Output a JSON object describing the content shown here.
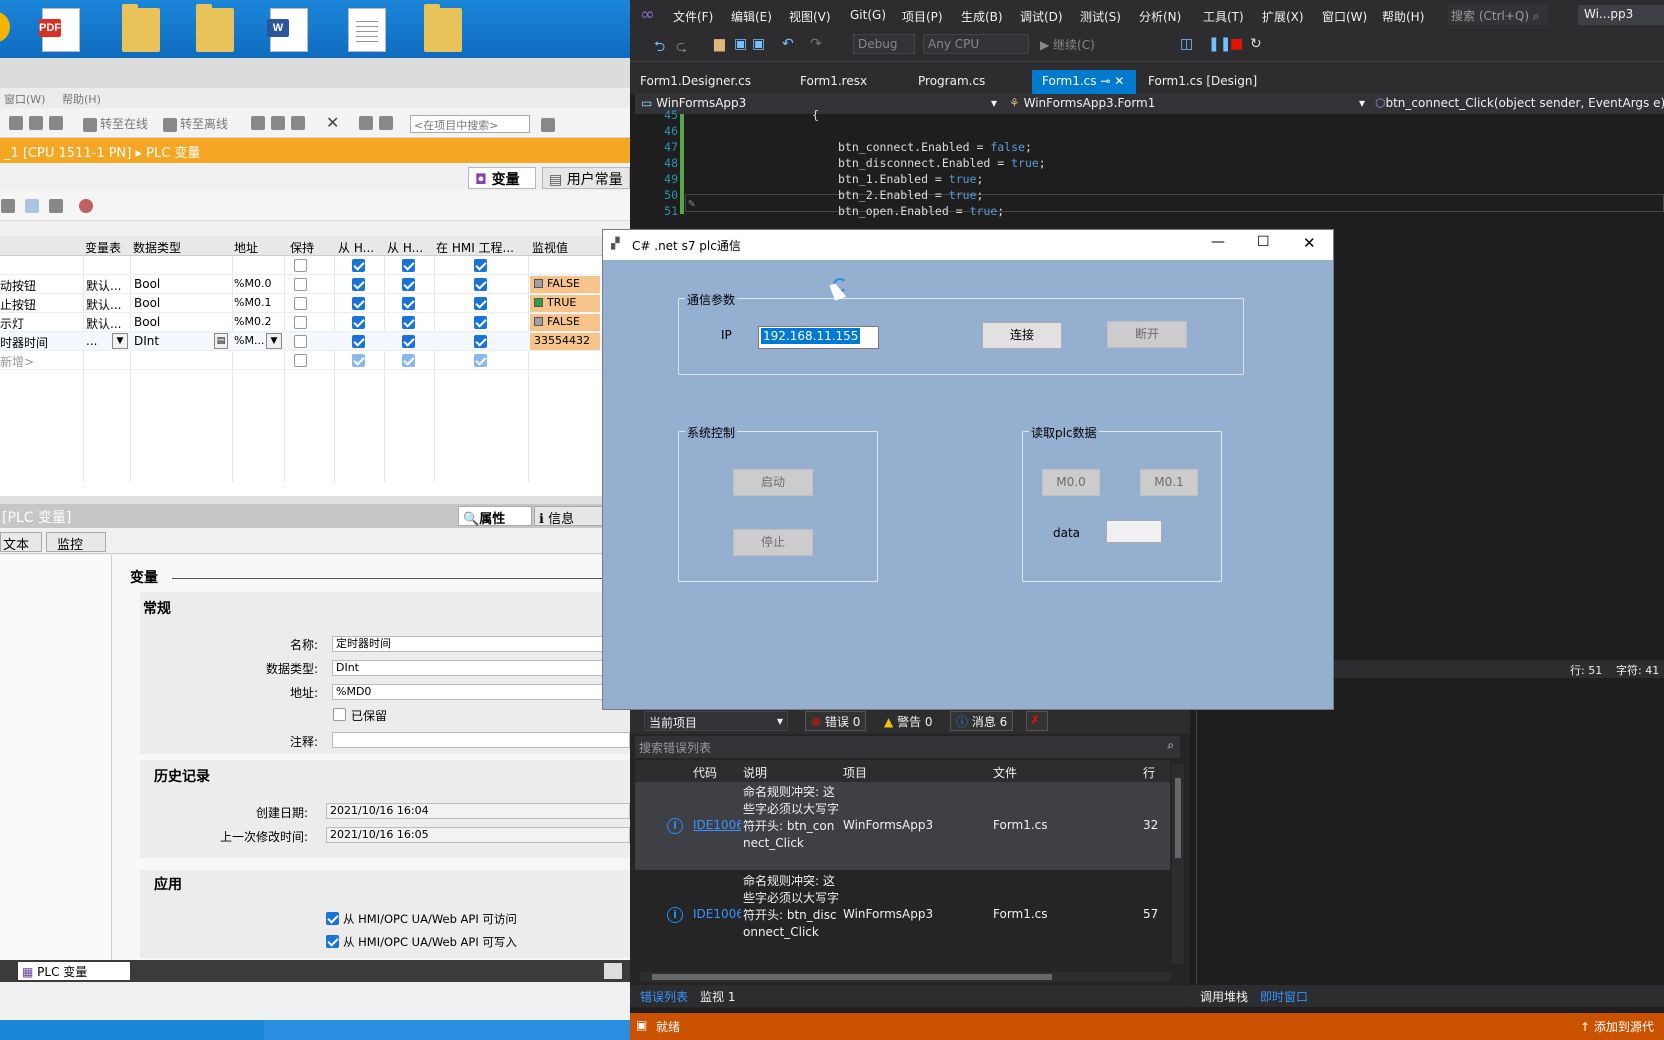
{
  "tia": {
    "menu": [
      "窗口(W)",
      "帮助(H)"
    ],
    "toolbar": {
      "go_online": "转至在线",
      "go_offline": "转至离线",
      "search_placeholder": "<在项目中搜索>"
    },
    "breadcrumb": "_1 [CPU 1511-1 PN]  ▸  PLC 变量",
    "tabs": [
      "变量",
      "用户常量"
    ],
    "grid": {
      "headers": [
        "变量表",
        "数据类型",
        "地址",
        "保持",
        "从 H...",
        "从 H...",
        "在 HMI 工程...",
        "监视值"
      ],
      "rows": [
        {
          "name": "动按钮",
          "table": "默认...",
          "type": "Bool",
          "addr": "%M0.0",
          "mon": "FALSE",
          "mon_color": "#a0a0a0"
        },
        {
          "name": "止按钮",
          "table": "默认...",
          "type": "Bool",
          "addr": "%M0.1",
          "mon": "TRUE",
          "mon_color": "#2ea043"
        },
        {
          "name": "示灯",
          "table": "默认...",
          "type": "Bool",
          "addr": "%M0.2",
          "mon": "FALSE",
          "mon_color": "#a0a0a0"
        },
        {
          "name": "时器时间",
          "table": "...",
          "type": "DInt",
          "addr": "%M...",
          "mon": "33554432",
          "mon_color": ""
        }
      ],
      "add_row": "新增>"
    },
    "props": {
      "header": "[PLC 变量]",
      "tabs": [
        "属性",
        "信息"
      ],
      "subtabs": [
        "文本",
        "监控"
      ],
      "section_title": "变量",
      "general": "常规",
      "name_label": "名称:",
      "name_value": "定时器时间",
      "type_label": "数据类型:",
      "type_value": "DInt",
      "addr_label": "地址:",
      "addr_value": "%MD0",
      "retain_label": "已保留",
      "comment_label": "注释:",
      "history": "历史记录",
      "created_label": "创建日期:",
      "created_value": "2021/10/16 16:04",
      "modified_label": "上一次修改时间:",
      "modified_value": "2021/10/16 16:05",
      "apply": "应用",
      "access1": "从 HMI/OPC UA/Web API 可访问",
      "access2": "从 HMI/OPC UA/Web API 可写入"
    },
    "status_tab": "PLC 变量"
  },
  "vs": {
    "menu": [
      "文件(F)",
      "编辑(E)",
      "视图(V)",
      "Git(G)",
      "项目(P)",
      "生成(B)",
      "调试(D)",
      "测试(S)",
      "分析(N)",
      "工具(T)",
      "扩展(X)",
      "窗口(W)",
      "帮助(H)"
    ],
    "search": "搜索 (Ctrl+Q)",
    "solution": "Wi...pp3",
    "config": "Debug",
    "platform": "Any CPU",
    "attach": "继续(C)",
    "tabs": [
      "Form1.Designer.cs",
      "Form1.resx",
      "Program.cs",
      "Form1.cs",
      "Form1.cs [Design]"
    ],
    "nav": {
      "project": "WinFormsApp3",
      "class": "WinFormsApp3.Form1",
      "member": "btn_connect_Click(object sender, EventArgs e)"
    },
    "code": [
      {
        "n": "45",
        "t": "{"
      },
      {
        "n": "46",
        "t": ""
      },
      {
        "n": "47",
        "t": "btn_connect.Enabled = ",
        "kw": "false",
        "end": ";"
      },
      {
        "n": "48",
        "t": "btn_disconnect.Enabled = ",
        "kw": "true",
        "end": ";"
      },
      {
        "n": "49",
        "t": "btn_1.Enabled = ",
        "kw": "true",
        "end": ";"
      },
      {
        "n": "50",
        "t": "btn_2.Enabled = ",
        "kw": "true",
        "end": ";"
      },
      {
        "n": "51",
        "t": "btn_open.Enabled = ",
        "kw": "true",
        "end": ";"
      }
    ],
    "edit_status": {
      "line": "行: 51",
      "col": "字符: 41"
    },
    "errors": {
      "scope": "当前项目",
      "err": "错误 0",
      "warn": "警告 0",
      "msg": "消息 6",
      "search": "搜索错误列表",
      "headers": [
        "代码",
        "说明",
        "项目",
        "文件",
        "行"
      ],
      "rows": [
        {
          "code": "IDE1006",
          "desc": "命名规则冲突: 这些字必须以大写字符开头: btn_connect_Click",
          "project": "WinFormsApp3",
          "file": "Form1.cs",
          "line": "32"
        },
        {
          "code": "IDE1006",
          "desc": "命名规则冲突: 这些字必须以大写字符开头: btn_disconnect_Click",
          "project": "WinFormsApp3",
          "file": "Form1.cs",
          "line": "57"
        }
      ]
    },
    "bottom_tabs": [
      "错误列表",
      "监视 1"
    ],
    "right_tabs": [
      "调用堆栈",
      "即时窗口"
    ],
    "status": "就绪",
    "source_control": "添加到源代"
  },
  "form": {
    "title": "C# .net s7 plc通信",
    "comm_group": "通信参数",
    "ip_label": "IP",
    "ip_value": "192.168.11.155",
    "connect": "连接",
    "disconnect": "断开",
    "sys_group": "系统控制",
    "start": "启动",
    "stop": "停止",
    "read_group": "读取plc数据",
    "m00": "M0.0",
    "m01": "M0.1",
    "data_label": "data",
    "data_value": ""
  },
  "colors": {
    "vs_status": "#ca5100",
    "vs_accent": "#007acc",
    "tia_orange": "#f5a623",
    "form_bg": "#94afd0"
  }
}
